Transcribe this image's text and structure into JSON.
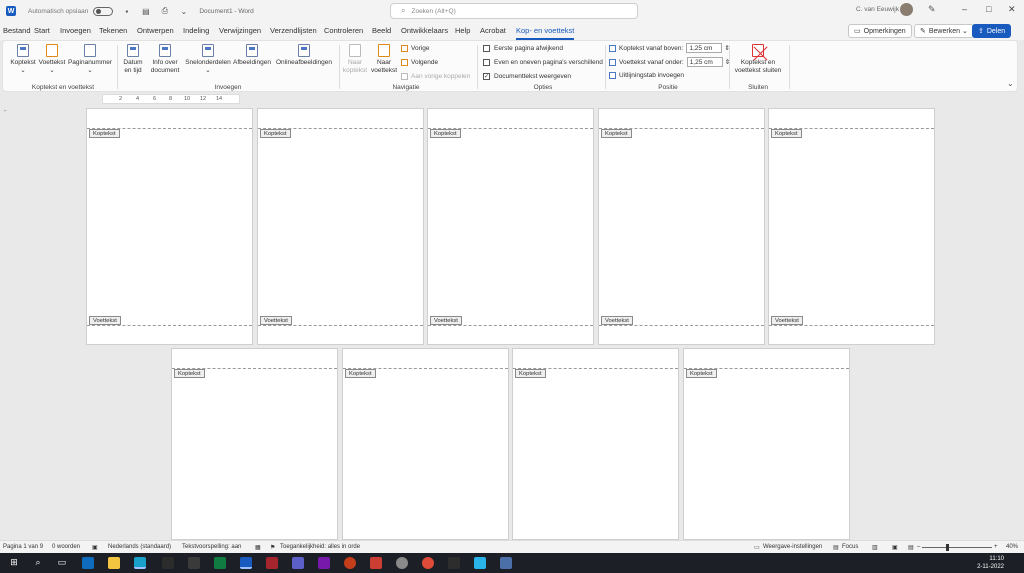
{
  "titlebar": {
    "app_letter": "W",
    "autosave_label": "Automatisch opslaan",
    "document_title": "Document1 - Word",
    "search_placeholder": "Zoeken (Alt+Q)",
    "user_name": "C. van Eeuwijk",
    "colors": {
      "word_blue": "#185abd"
    }
  },
  "menu": {
    "tabs": [
      "Bestand",
      "Start",
      "Invoegen",
      "Tekenen",
      "Ontwerpen",
      "Indeling",
      "Verwijzingen",
      "Verzendlijsten",
      "Controleren",
      "Beeld",
      "Ontwikkelaars",
      "Help",
      "Acrobat",
      "Kop- en voettekst"
    ],
    "active_tab": "Kop- en voettekst",
    "comments_label": "Opmerkingen",
    "edit_label": "Bewerken",
    "share_label": "Delen"
  },
  "ribbon": {
    "groups": {
      "header_footer": {
        "label": "Koptekst en voettekst",
        "buttons": [
          "Koptekst",
          "Voettekst",
          "Paginanummer"
        ]
      },
      "insert": {
        "label": "Invoegen",
        "date_time": [
          "Datum",
          "en tijd"
        ],
        "doc_info": [
          "Info over",
          "document"
        ],
        "quick_parts": "Snelonderdelen",
        "pictures": "Afbeeldingen",
        "online_pictures": "Onlineafbeeldingen"
      },
      "navigation": {
        "label": "Navigatie",
        "goto_header": [
          "Naar",
          "koptekst"
        ],
        "goto_footer": [
          "Naar",
          "voettekst"
        ],
        "previous": "Vorige",
        "next": "Volgende",
        "link_to_previous": "Aan vorige koppelen"
      },
      "options": {
        "label": "Opties",
        "different_first_page": "Eerste pagina afwijkend",
        "different_odd_even": "Even en oneven pagina's verschillend",
        "show_document_text": "Documenttekst weergeven",
        "show_document_text_checked": true
      },
      "position": {
        "label": "Positie",
        "header_from_top_label": "Koptekst vanaf boven:",
        "header_from_top_value": "1,25 cm",
        "footer_from_bottom_label": "Voettekst vanaf onder:",
        "footer_from_bottom_value": "1,25 cm",
        "insert_alignment_tab": "Uitlijningstab invoegen"
      },
      "close": {
        "label": "Sluiten",
        "button": [
          "Koptekst en",
          "voettekst sluiten"
        ]
      }
    }
  },
  "ruler": {
    "ticks": [
      "2",
      "4",
      "6",
      "8",
      "10",
      "12",
      "14"
    ]
  },
  "pages": {
    "header_label": "Koptekst",
    "footer_label": "Voettekst"
  },
  "statusbar": {
    "page_info": "Pagina 1 van 9",
    "word_count": "0 woorden",
    "language": "Nederlands (standaard)",
    "text_predictions": "Tekstvoorspelling: aan",
    "accessibility": "Toegankelijkheid: alles in orde",
    "display_settings": "Weergave-instellingen",
    "focus": "Focus",
    "zoom": "40%"
  },
  "taskbar": {
    "time": "11:10",
    "date": "2-11-2022"
  }
}
